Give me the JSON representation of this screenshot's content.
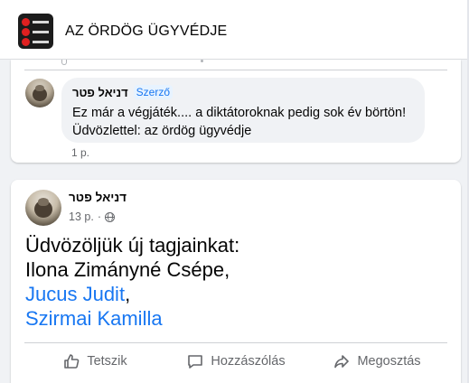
{
  "header": {
    "group_title": "AZ ÖRDÖG ÜGYVÉDJE",
    "avatar_lines": [
      "Orbán",
      "fidesz",
      "KORR"
    ]
  },
  "comment": {
    "author": "דניאל פטר",
    "badge": "Szerző",
    "line1": "Ez már a végjáték.... a diktátoroknak pedig sok év börtön!",
    "line2": "Üdvözlettel: az ördög ügyvédje",
    "time": "1 p."
  },
  "post": {
    "author": "דניאל פטר",
    "time": "13 p.",
    "separator": "·",
    "audience_icon": "globe-icon",
    "line1": "Üdvözöljük új tagjainkat:",
    "line2": "Ilona Zimányné Csépe,",
    "member1": "Jucus Judit",
    "comma": ",",
    "member2": "Szirmai Kamilla"
  },
  "actions": {
    "like": "Tetszik",
    "comment": "Hozzászólás",
    "share": "Megosztás"
  },
  "colors": {
    "link": "#1877f2",
    "secondary_text": "#65676b",
    "background": "#f0f2f5"
  }
}
